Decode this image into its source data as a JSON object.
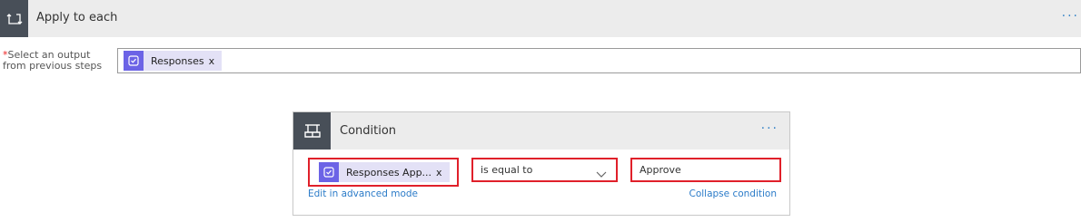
{
  "loop": {
    "title": "Apply to each",
    "more": "···",
    "required_label_line1": "Select an output",
    "required_label_line2": "from previous steps",
    "required_marker": "*",
    "output_token": {
      "label": "Responses",
      "remove": "x"
    }
  },
  "condition": {
    "title": "Condition",
    "more": "···",
    "left_token": {
      "label": "Responses App...",
      "remove": "x"
    },
    "operator": {
      "selected": "is equal to"
    },
    "value": "Approve",
    "edit_advanced_link": "Edit in advanced mode",
    "collapse_link": "Collapse condition"
  },
  "colors": {
    "header_bg": "#ececec",
    "icon_box_bg": "#484f58",
    "token_bg": "#e3e1f6",
    "token_icon_bg": "#6c63e6",
    "highlight": "#e0202a",
    "link": "#2b7bc8"
  },
  "icons": {
    "loop": "loop-icon",
    "condition": "condition-icon",
    "approvals": "approvals-icon",
    "dropdown": "chevron-down-icon"
  }
}
